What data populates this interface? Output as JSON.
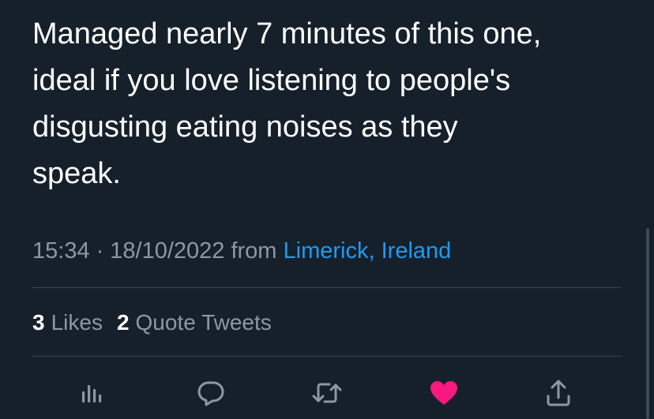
{
  "tweet": {
    "text": "Managed nearly 7 minutes of this one,\nideal if you love listening to people's\ndisgusting eating noises as they\nspeak.",
    "time": "15:34",
    "separator": "·",
    "date": "18/10/2022",
    "from_label": "from",
    "location": "Limerick, Ireland"
  },
  "stats": {
    "likes_count": "3",
    "likes_label": "Likes",
    "quotes_count": "2",
    "quotes_label": "Quote Tweets"
  },
  "actions": {
    "views_icon": "bar-chart-icon",
    "reply_icon": "comment-bubble-icon",
    "retweet_icon": "retweet-arrows-icon",
    "like_icon": "heart-filled-icon",
    "share_icon": "share-upload-icon"
  },
  "colors": {
    "background": "#15202b",
    "text_primary": "#ffffff",
    "text_secondary": "#8b98a5",
    "link": "#1d9bf0",
    "like": "#f91880",
    "divider": "#38444d"
  }
}
